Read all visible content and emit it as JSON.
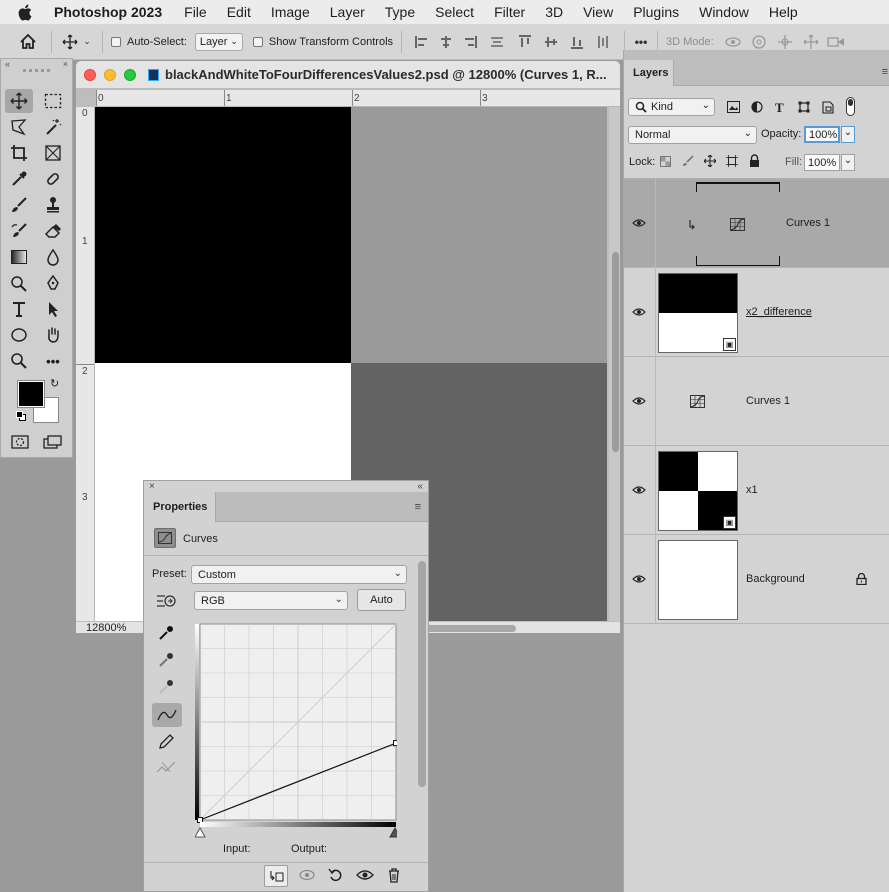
{
  "menubar": {
    "app": "Photoshop 2023",
    "items": [
      "File",
      "Edit",
      "Image",
      "Layer",
      "Type",
      "Select",
      "Filter",
      "3D",
      "View",
      "Plugins",
      "Window",
      "Help"
    ]
  },
  "options": {
    "auto_select_label": "Auto-Select:",
    "auto_select_value": "Layer",
    "show_transform_label": "Show Transform Controls",
    "mode_3d_label": "3D Mode:"
  },
  "document": {
    "title": "blackAndWhiteToFourDifferencesValues2.psd @ 12800% (Curves 1, R...",
    "zoom": "12800%",
    "ruler_h": [
      "0",
      "1",
      "2",
      "3"
    ],
    "ruler_v": [
      "0",
      "1",
      "2",
      "3"
    ],
    "quadrants": {
      "top_left": "#000000",
      "top_right": "#9a9a9a",
      "bottom_left": "#ffffff",
      "bottom_right": "#636363"
    }
  },
  "properties": {
    "tab": "Properties",
    "adjustment": "Curves",
    "preset_label": "Preset:",
    "preset_value": "Custom",
    "channel_value": "RGB",
    "auto_button": "Auto",
    "input_label": "Input:",
    "output_label": "Output:",
    "curve_points": [
      [
        0,
        0
      ],
      [
        255,
        100
      ]
    ]
  },
  "layers": {
    "tab": "Layers",
    "filter_kind": "Kind",
    "blend_mode": "Normal",
    "opacity_label": "Opacity:",
    "opacity_value": "100%",
    "lock_label": "Lock:",
    "fill_label": "Fill:",
    "fill_value": "100%",
    "items": [
      {
        "name": "Curves 1",
        "type": "adjustment",
        "clipped": true,
        "selected": true
      },
      {
        "name": "x2_difference",
        "type": "smart",
        "selected": false
      },
      {
        "name": "Curves 1",
        "type": "adjustment",
        "clipped": false,
        "selected": false
      },
      {
        "name": "x1",
        "type": "smart",
        "selected": false
      },
      {
        "name": "Background",
        "type": "background",
        "locked": true,
        "selected": false
      }
    ]
  }
}
